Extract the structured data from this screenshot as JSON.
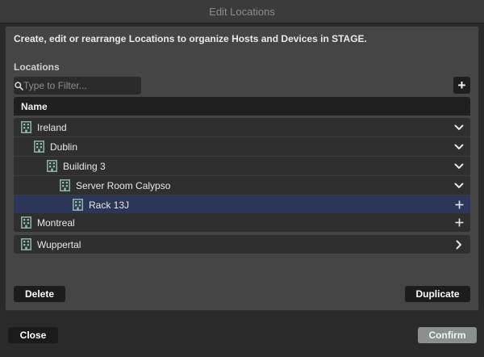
{
  "window": {
    "title": "Edit Locations"
  },
  "intro_text": "Create, edit or rearrange Locations to organize Hosts and Devices in STAGE.",
  "section_label": "Locations",
  "filter": {
    "placeholder": "Type to Filter...",
    "value": ""
  },
  "table": {
    "header": "Name"
  },
  "tree": [
    {
      "label": "Ireland",
      "level": 0,
      "action": "chevron-down",
      "selected": false
    },
    {
      "label": "Dublin",
      "level": 1,
      "action": "chevron-down",
      "selected": false
    },
    {
      "label": "Building 3",
      "level": 2,
      "action": "chevron-down",
      "selected": false
    },
    {
      "label": "Server Room Calypso",
      "level": 3,
      "action": "chevron-down",
      "selected": false
    },
    {
      "label": "Rack 13J",
      "level": 4,
      "action": "plus",
      "selected": true
    },
    {
      "label": "Montreal",
      "level": 0,
      "action": "plus",
      "selected": false
    },
    {
      "label": "Wuppertal",
      "level": 0,
      "action": "chevron-right",
      "selected": false
    }
  ],
  "buttons": {
    "delete": "Delete",
    "duplicate": "Duplicate",
    "close": "Close",
    "confirm": "Confirm"
  },
  "colors": {
    "selected_row": "#2b3658",
    "confirm_bg": "#8a9090",
    "building_icon": "#8fb8a8"
  }
}
